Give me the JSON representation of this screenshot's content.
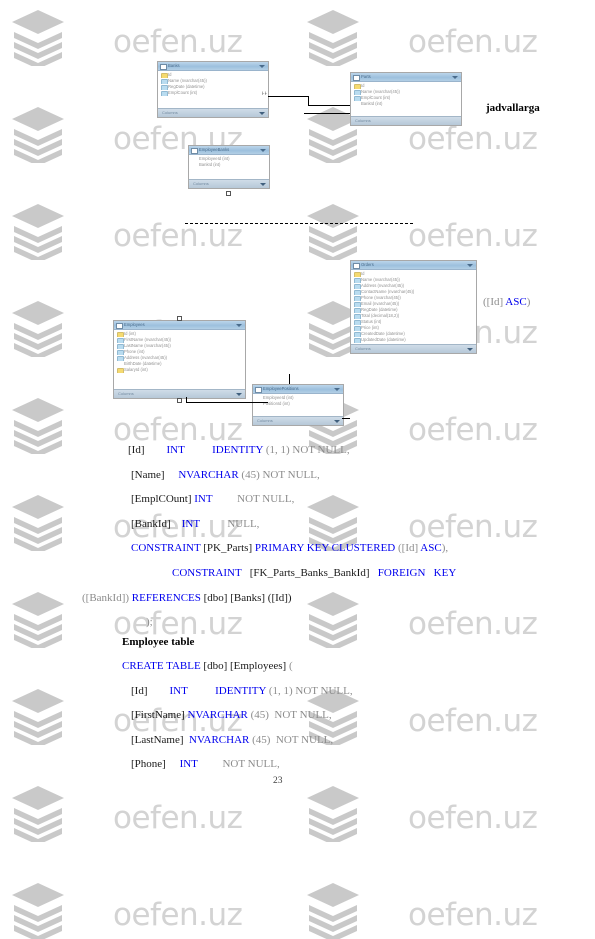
{
  "document": {
    "page_number": "23",
    "watermark_text": "oefen.uz",
    "watermark_color": "#d3d3d3",
    "keyword_color": "#0000ee",
    "plain_color": "#808080"
  },
  "annotations": {
    "jadvallarga": "jadvallarga",
    "id_asc": "([Id] ASC)"
  },
  "diagram": {
    "tables": [
      {
        "name": "bank-table-top-left",
        "title": "Banks",
        "rows": [
          "Id",
          "Name (nvarchar(45))",
          "RegDate (datetime)",
          "EmplCount (int)"
        ],
        "footer": "Columns"
      },
      {
        "name": "parts-table-top-right",
        "title": "Parts",
        "rows": [
          "Id",
          "Name (nvarchar(45))",
          "EmplCount (int)",
          "BankId (int)"
        ],
        "footer": "Columns"
      },
      {
        "name": "employee-bank-table-mid",
        "title": "EmployeeBanks",
        "rows": [
          "EmployeeId (int)",
          "BankId (int)"
        ],
        "footer": "Columns"
      },
      {
        "name": "orders-table-right",
        "title": "Orders",
        "rows": [
          "Id",
          "Name (nvarchar(45))",
          "Address (nvarchar(45))",
          "ContactName (nvarchar(45))",
          "Phone (nvarchar(45))",
          "Email (nvarchar(45))",
          "RegDate (datetime)",
          "Total (decimal(18,2))",
          "Status (int)",
          "Price (int)",
          "CreatedDate (datetime)",
          "UpdatedDate (datetime)"
        ],
        "footer": "Columns"
      },
      {
        "name": "employees-table-left",
        "title": "Employees",
        "rows": [
          "Id (int)",
          "FirstName (nvarchar(45))",
          "LastName (nvarchar(45))",
          "Phone (int)",
          "Address (nvarchar(45))",
          "BirthDate (datetime)",
          "SalaryId (int)"
        ],
        "footer": "Columns"
      },
      {
        "name": "employee-positions-table",
        "title": "EmployeePositions",
        "rows": [
          "EmployeeId (int)",
          "PositionId (int)"
        ],
        "footer": "Columns"
      }
    ]
  },
  "code": {
    "parts_table_lines": [
      {
        "indent": 128,
        "segments": [
          {
            "t": "[Id]",
            "c": "id"
          },
          {
            "t": "        ",
            "c": "gr"
          },
          {
            "t": "INT",
            "c": "kw"
          },
          {
            "t": "          ",
            "c": "gr"
          },
          {
            "t": "IDENTITY",
            "c": "kw"
          },
          {
            "t": " (1, 1) NOT NULL,",
            "c": "gr"
          }
        ]
      },
      {
        "indent": 131,
        "segments": [
          {
            "t": "[Name]",
            "c": "id"
          },
          {
            "t": "     ",
            "c": "gr"
          },
          {
            "t": "NVARCHAR",
            "c": "kw"
          },
          {
            "t": " (45) NOT NULL,",
            "c": "gr"
          }
        ]
      },
      {
        "indent": 131,
        "segments": [
          {
            "t": "[EmplCOunt]",
            "c": "id"
          },
          {
            "t": " ",
            "c": "gr"
          },
          {
            "t": "INT",
            "c": "kw"
          },
          {
            "t": "         NOT NULL,",
            "c": "gr"
          }
        ]
      },
      {
        "indent": 131,
        "segments": [
          {
            "t": "[BankId]",
            "c": "id"
          },
          {
            "t": "    ",
            "c": "gr"
          },
          {
            "t": "INT",
            "c": "kw"
          },
          {
            "t": "          NULL,",
            "c": "gr"
          }
        ]
      },
      {
        "indent": 131,
        "segments": [
          {
            "t": "CONSTRAINT",
            "c": "kw"
          },
          {
            "t": " [PK_Parts] ",
            "c": "id"
          },
          {
            "t": "PRIMARY KEY CLUSTERED",
            "c": "kw"
          },
          {
            "t": " ([Id] ",
            "c": "gr"
          },
          {
            "t": "ASC",
            "c": "kw"
          },
          {
            "t": "),",
            "c": "gr"
          }
        ]
      },
      {
        "indent": 172,
        "segments": [
          {
            "t": "CONSTRAINT",
            "c": "kw"
          },
          {
            "t": "   [FK_Parts_Banks_BankId]   ",
            "c": "id"
          },
          {
            "t": "FOREIGN   KEY",
            "c": "kw"
          }
        ]
      },
      {
        "indent": 82,
        "segments": [
          {
            "t": "([BankId])",
            "c": "gr"
          },
          {
            "t": " ",
            "c": "gr"
          },
          {
            "t": "REFERENCES",
            "c": "kw"
          },
          {
            "t": " [dbo] [Banks] ([Id])",
            "c": "id"
          }
        ]
      },
      {
        "indent": 146,
        "segments": [
          {
            "t": ");",
            "c": "gr"
          }
        ]
      }
    ],
    "employee_heading": "Employee table",
    "employee_table_lines": [
      {
        "indent": 122,
        "segments": [
          {
            "t": "CREATE TABLE",
            "c": "kw"
          },
          {
            "t": " [dbo] [Employees] ",
            "c": "id"
          },
          {
            "t": "(",
            "c": "gr"
          }
        ]
      },
      {
        "indent": 131,
        "segments": [
          {
            "t": "[Id]",
            "c": "id"
          },
          {
            "t": "        ",
            "c": "gr"
          },
          {
            "t": "INT",
            "c": "kw"
          },
          {
            "t": "          ",
            "c": "gr"
          },
          {
            "t": "IDENTITY",
            "c": "kw"
          },
          {
            "t": " (1, 1) NOT NULL,",
            "c": "gr"
          }
        ]
      },
      {
        "indent": 131,
        "segments": [
          {
            "t": "[FirstName]",
            "c": "id"
          },
          {
            "t": " ",
            "c": "gr"
          },
          {
            "t": "NVARCHAR",
            "c": "kw"
          },
          {
            "t": " (45)  NOT NULL,",
            "c": "gr"
          }
        ]
      },
      {
        "indent": 131,
        "segments": [
          {
            "t": "[LastName]",
            "c": "id"
          },
          {
            "t": "  ",
            "c": "gr"
          },
          {
            "t": "NVARCHAR",
            "c": "kw"
          },
          {
            "t": " (45)  NOT NULL,",
            "c": "gr"
          }
        ]
      },
      {
        "indent": 131,
        "segments": [
          {
            "t": "[Phone]",
            "c": "id"
          },
          {
            "t": "     ",
            "c": "gr"
          },
          {
            "t": "INT",
            "c": "kw"
          },
          {
            "t": "         NOT NULL,",
            "c": "gr"
          }
        ]
      }
    ]
  }
}
